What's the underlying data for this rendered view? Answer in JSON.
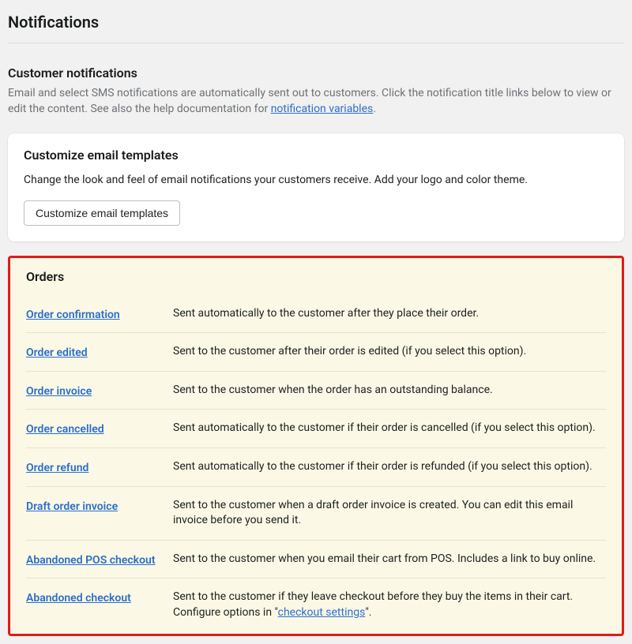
{
  "page": {
    "title": "Notifications"
  },
  "customer": {
    "section_title": "Customer notifications",
    "desc_1": "Email and select SMS notifications are automatically sent out to customers. Click the notification title links below to view or edit the content. See also the help documentation for ",
    "link_text": "notification variables",
    "desc_2": "."
  },
  "customize": {
    "title": "Customize email templates",
    "desc": "Change the look and feel of email notifications your customers receive. Add your logo and color theme.",
    "button": "Customize email templates"
  },
  "orders": {
    "title": "Orders",
    "rows": [
      {
        "name": "Order confirmation",
        "desc": "Sent automatically to the customer after they place their order."
      },
      {
        "name": "Order edited",
        "desc": "Sent to the customer after their order is edited (if you select this option)."
      },
      {
        "name": "Order invoice",
        "desc": "Sent to the customer when the order has an outstanding balance."
      },
      {
        "name": "Order cancelled",
        "desc": "Sent automatically to the customer if their order is cancelled (if you select this option)."
      },
      {
        "name": "Order refund",
        "desc": "Sent automatically to the customer if their order is refunded (if you select this option)."
      },
      {
        "name": "Draft order invoice",
        "desc": "Sent to the customer when a draft order invoice is created. You can edit this email invoice before you send it."
      },
      {
        "name": "Abandoned POS checkout",
        "desc": "Sent to the customer when you email their cart from POS. Includes a link to buy online."
      },
      {
        "name": "Abandoned checkout",
        "desc_pre": "Sent to the customer if they leave checkout before they buy the items in their cart. Configure options in \"",
        "link": "checkout settings",
        "desc_post": "\"."
      }
    ]
  }
}
